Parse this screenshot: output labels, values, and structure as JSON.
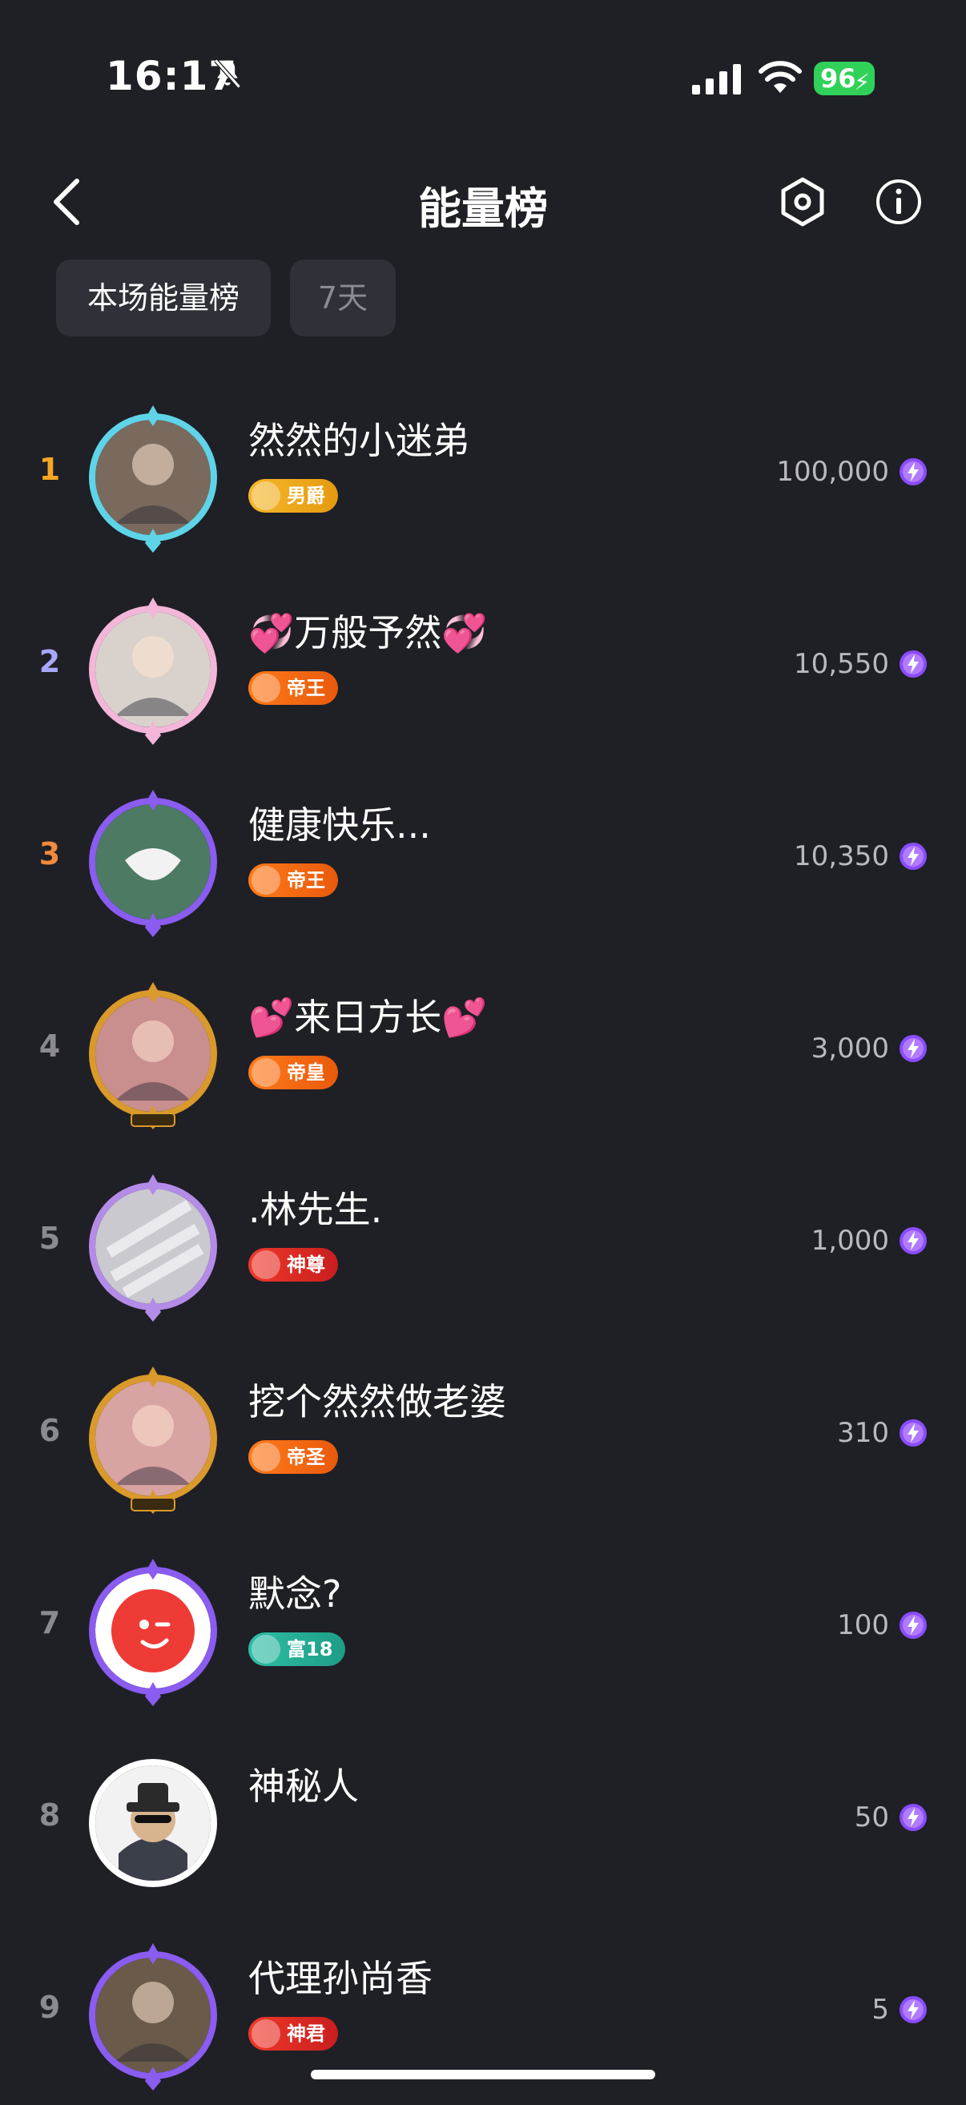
{
  "status_bar": {
    "time": "16:17",
    "battery": "96"
  },
  "header": {
    "title": "能量榜"
  },
  "tabs": [
    {
      "label": "本场能量榜"
    },
    {
      "label": "7天"
    }
  ],
  "colors": {
    "background": "#1f1f26",
    "rank1": "#f5a623",
    "rank2": "#a8a8ff",
    "rank3": "#f08a3c",
    "bolt": "#8a4cff"
  },
  "entries": [
    {
      "rank": "1",
      "name": "然然的小迷弟",
      "badge": "男爵",
      "score": "100,000"
    },
    {
      "rank": "2",
      "name": "💞万般予然💞",
      "badge": "帝王",
      "score": "10,550"
    },
    {
      "rank": "3",
      "name": "健康快乐...",
      "badge": "帝王",
      "score": "10,350"
    },
    {
      "rank": "4",
      "name": "💕来日方长💕",
      "badge": "帝皇",
      "score": "3,000"
    },
    {
      "rank": "5",
      "name": ".林先生.",
      "badge": "神尊",
      "score": "1,000"
    },
    {
      "rank": "6",
      "name": "挖个然然做老婆",
      "badge": "帝圣",
      "score": "310"
    },
    {
      "rank": "7",
      "name": "默念?",
      "badge": "富18",
      "score": "100"
    },
    {
      "rank": "8",
      "name": "神秘人",
      "badge": "",
      "score": "50"
    },
    {
      "rank": "9",
      "name": "代理孙尚香",
      "badge": "神君",
      "score": "5"
    }
  ]
}
